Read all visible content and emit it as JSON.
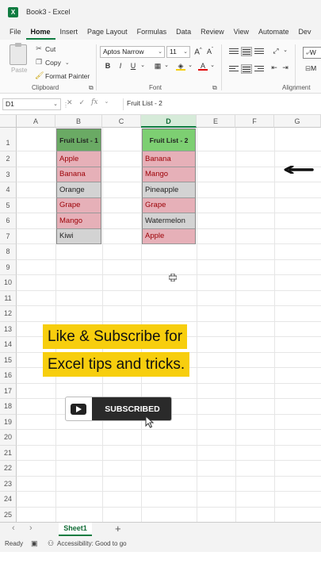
{
  "window": {
    "app_icon": "X",
    "title": "Book3 - Excel"
  },
  "menu": [
    "File",
    "Home",
    "Insert",
    "Page Layout",
    "Formulas",
    "Data",
    "Review",
    "View",
    "Automate",
    "Dev"
  ],
  "ribbon": {
    "clipboard": {
      "paste": "Paste",
      "cut": "Cut",
      "copy": "Copy",
      "format_painter": "Format Painter",
      "label": "Clipboard"
    },
    "font": {
      "family": "Aptos Narrow",
      "size": "11",
      "bold": "B",
      "italic": "I",
      "underline": "U",
      "label": "Font",
      "fill_color": "#f7ce0e",
      "font_color": "#e00000"
    },
    "alignment": {
      "label": "Alignment"
    },
    "partial_buttons": [
      "W",
      "M"
    ]
  },
  "formula_bar": {
    "name_box": "D1",
    "cancel": "✕",
    "enter": "✓",
    "fx": "fx",
    "content": "Fruit List - 2"
  },
  "sheet": {
    "columns": [
      "A",
      "B",
      "C",
      "D",
      "E",
      "F",
      "G"
    ],
    "selected_column": "D",
    "rows": [
      "1",
      "2",
      "3",
      "4",
      "5",
      "6",
      "7",
      "8",
      "9",
      "10",
      "11",
      "12",
      "13",
      "14",
      "15",
      "16",
      "17",
      "18",
      "19",
      "20",
      "21",
      "22",
      "23",
      "24",
      "25"
    ],
    "list1": {
      "header": "Fruit List - 1",
      "header_color": "#6aaa64",
      "items": [
        {
          "name": "Apple",
          "dup": true
        },
        {
          "name": "Banana",
          "dup": true
        },
        {
          "name": "Orange",
          "dup": false
        },
        {
          "name": "Grape",
          "dup": true
        },
        {
          "name": "Mango",
          "dup": true
        },
        {
          "name": "Kiwi",
          "dup": false
        }
      ]
    },
    "list2": {
      "header": "Fruit List - 2",
      "header_color": "#7dcf72",
      "items": [
        {
          "name": "Banana",
          "dup": true
        },
        {
          "name": "Mango",
          "dup": true
        },
        {
          "name": "Pineapple",
          "dup": false
        },
        {
          "name": "Grape",
          "dup": true
        },
        {
          "name": "Watermelon",
          "dup": false
        },
        {
          "name": "Apple",
          "dup": true
        }
      ]
    }
  },
  "overlay": {
    "line1": "Like & Subscribe for",
    "line2": "Excel tips and tricks.",
    "subscribe": "SUBSCRIBED"
  },
  "sheet_tabs": {
    "prev": "‹",
    "next": "›",
    "active": "Sheet1",
    "add": "+"
  },
  "status": {
    "ready": "Ready",
    "accessibility": "Accessibility: Good to go"
  }
}
